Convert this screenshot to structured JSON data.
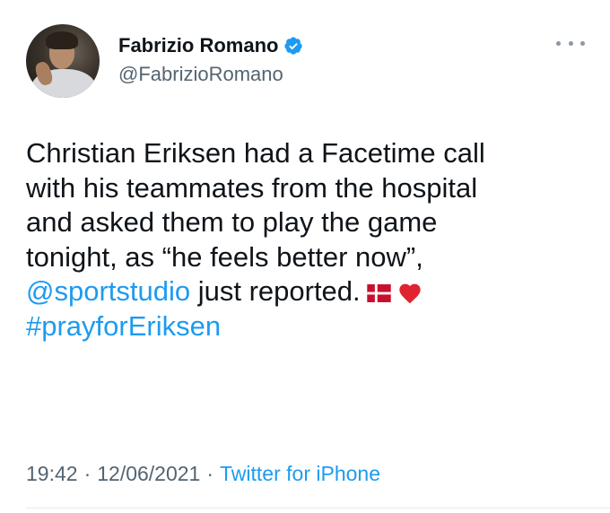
{
  "author": {
    "name": "Fabrizio Romano",
    "handle": "@FabrizioRomano",
    "verified": true
  },
  "tweet": {
    "lines": [
      "Christian Eriksen had a Facetime call",
      "with his teammates from the hospital",
      "and asked them to play the game",
      "tonight, as “he feels better now”,"
    ],
    "mention": "@sportstudio",
    "line5_rest": " just reported.",
    "hashtag": "#prayforEriksen",
    "emoji": [
      "denmark-flag",
      "red-heart"
    ]
  },
  "meta": {
    "time": "19:42",
    "separator": "·",
    "date": "12/06/2021",
    "source": "Twitter for iPhone"
  },
  "colors": {
    "link": "#1d9bf0",
    "text": "#0f1419",
    "secondary": "#536471",
    "verified": "#1d9bf0",
    "heart": "#e0242f",
    "flag_red": "#c8102e"
  }
}
